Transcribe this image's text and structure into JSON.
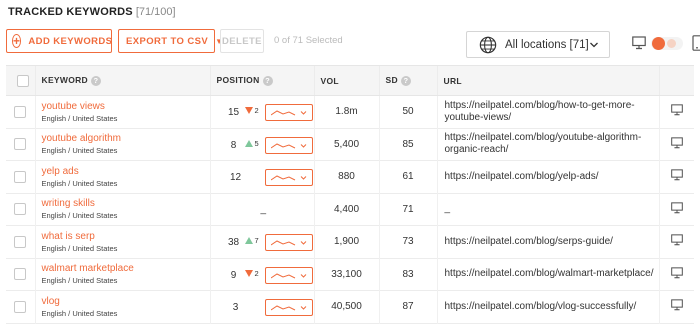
{
  "header": {
    "title": "TRACKED KEYWORDS",
    "count": "[71/100]"
  },
  "toolbar": {
    "add_label": "ADD KEYWORDS",
    "export_label": "EXPORT TO CSV",
    "delete_label": "DELETE",
    "selected_text": "0 of 71 Selected",
    "location": "All locations [71]"
  },
  "icons": {
    "add": "plus-circle-icon",
    "export_caret": "chevron-down-icon",
    "globe": "globe-icon",
    "desktop": "desktop-icon",
    "mobile": "mobile-icon",
    "help": "help-icon",
    "change_up": "triangle-up-icon",
    "change_down": "triangle-down-icon",
    "trend": "trend-chart-icon"
  },
  "colors": {
    "accent": "#f06b3c",
    "up": "#7fc79b",
    "header_bg": "#f5f5f5"
  },
  "table": {
    "columns": {
      "keyword": "KEYWORD",
      "position": "POSITION",
      "vol": "VOL",
      "sd": "SD",
      "url": "URL"
    },
    "help_glyph": "?",
    "rows": [
      {
        "keyword": "youtube views",
        "locale": "English / United States",
        "position": "15",
        "change_dir": "down",
        "change": "2",
        "vol": "1.8m",
        "sd": "50",
        "url": "https://neilpatel.com/blog/how-to-get-more-youtube-views/"
      },
      {
        "keyword": "youtube algorithm",
        "locale": "English / United States",
        "position": "8",
        "change_dir": "up",
        "change": "5",
        "vol": "5,400",
        "sd": "85",
        "url": "https://neilpatel.com/blog/youtube-algorithm-organic-reach/"
      },
      {
        "keyword": "yelp ads",
        "locale": "English / United States",
        "position": "12",
        "change_dir": "",
        "change": "",
        "vol": "880",
        "sd": "61",
        "url": "https://neilpatel.com/blog/yelp-ads/"
      },
      {
        "keyword": "writing skills",
        "locale": "English / United States",
        "position": "",
        "change_dir": "",
        "change": "",
        "position_text": "_",
        "vol": "4,400",
        "sd": "71",
        "url": "_"
      },
      {
        "keyword": "what is serp",
        "locale": "English / United States",
        "position": "38",
        "change_dir": "up",
        "change": "7",
        "vol": "1,900",
        "sd": "73",
        "url": "https://neilpatel.com/blog/serps-guide/"
      },
      {
        "keyword": "walmart marketplace",
        "locale": "English / United States",
        "position": "9",
        "change_dir": "down",
        "change": "2",
        "vol": "33,100",
        "sd": "83",
        "url": "https://neilpatel.com/blog/walmart-marketplace/"
      },
      {
        "keyword": "vlog",
        "locale": "English / United States",
        "position": "3",
        "change_dir": "",
        "change": "",
        "vol": "40,500",
        "sd": "87",
        "url": "https://neilpatel.com/blog/vlog-successfully/"
      }
    ]
  }
}
